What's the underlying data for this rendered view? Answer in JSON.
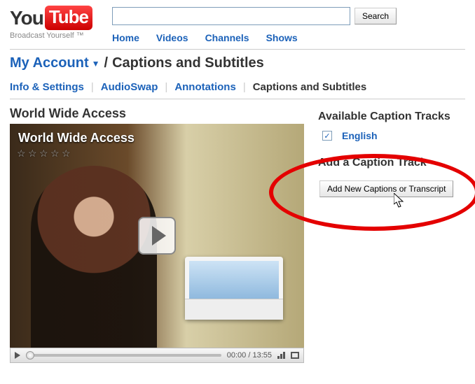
{
  "brand": {
    "you": "You",
    "tube": "Tube",
    "tagline": "Broadcast Yourself ™"
  },
  "search": {
    "value": "",
    "button": "Search"
  },
  "nav": {
    "home": "Home",
    "videos": "Videos",
    "channels": "Channels",
    "shows": "Shows"
  },
  "breadcrumb": {
    "account": "My Account",
    "separator": "/",
    "page": "Captions and Subtitles"
  },
  "subnav": {
    "info": "Info & Settings",
    "audioswap": "AudioSwap",
    "annotations": "Annotations",
    "captions": "Captions and Subtitles"
  },
  "video": {
    "title": "World Wide Access",
    "overlay_title": "World Wide Access",
    "current_time": "00:00",
    "duration": "13:55",
    "time_sep": " / "
  },
  "tracks": {
    "heading": "Available Caption Tracks",
    "items": [
      {
        "lang": "English",
        "checked": true
      }
    ]
  },
  "add": {
    "heading": "Add a Caption Track",
    "button": "Add New Captions or Transcript"
  }
}
